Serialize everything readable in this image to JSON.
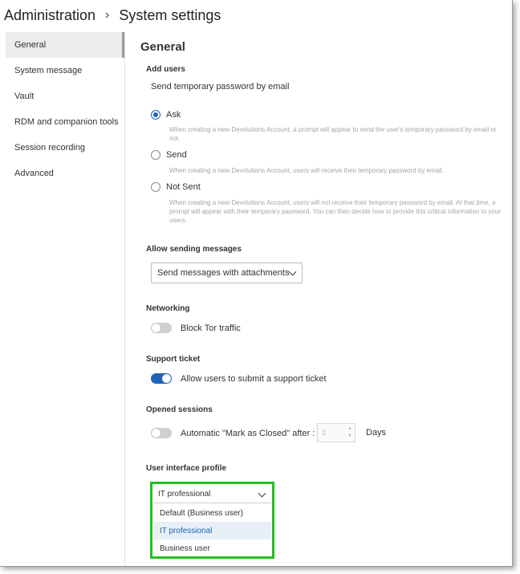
{
  "breadcrumb": {
    "root": "Administration",
    "separator": "›",
    "current": "System settings"
  },
  "sidebar": {
    "items": [
      {
        "label": "General",
        "active": true
      },
      {
        "label": "System message",
        "active": false
      },
      {
        "label": "Vault",
        "active": false
      },
      {
        "label": "RDM and companion tools",
        "active": false
      },
      {
        "label": "Session recording",
        "active": false
      },
      {
        "label": "Advanced",
        "active": false
      }
    ]
  },
  "main": {
    "title": "General",
    "add_users": {
      "heading": "Add users",
      "subheading": "Send temporary password by email",
      "options": [
        {
          "label": "Ask",
          "checked": true,
          "description": "When creating a new Devolutions Account, a prompt will appear to send the user's temporary password by email or not."
        },
        {
          "label": "Send",
          "checked": false,
          "description": "When creating a new Devolutions Account, users will receive their temporary password by email."
        },
        {
          "label": "Not Sent",
          "checked": false,
          "description": "When creating a new Devolutions Account, users will not receive their temporary password by email. At that time, a prompt will appear with their temporary password. You can then decide how to provide this critical information to your users."
        }
      ]
    },
    "messages": {
      "heading": "Allow sending messages",
      "selected": "Send messages with attachments"
    },
    "networking": {
      "heading": "Networking",
      "toggle_label": "Block Tor traffic",
      "on": false
    },
    "support": {
      "heading": "Support ticket",
      "toggle_label": "Allow users to submit a support ticket",
      "on": true
    },
    "sessions": {
      "heading": "Opened sessions",
      "toggle_label": "Automatic \"Mark as Closed\" after :",
      "on": false,
      "days_value": "2",
      "days_unit": "Days"
    },
    "ui_profile": {
      "heading": "User interface profile",
      "selected": "IT professional",
      "options": [
        "Default (Business user)",
        "IT professional",
        "Business user"
      ]
    }
  },
  "colors": {
    "accent": "#1e63b8",
    "highlight_border": "#22c020",
    "description_text": "#a5a5a5"
  },
  "icons": {
    "chevron": "chevron-down-icon",
    "stepper": "stepper-arrows-icon"
  }
}
